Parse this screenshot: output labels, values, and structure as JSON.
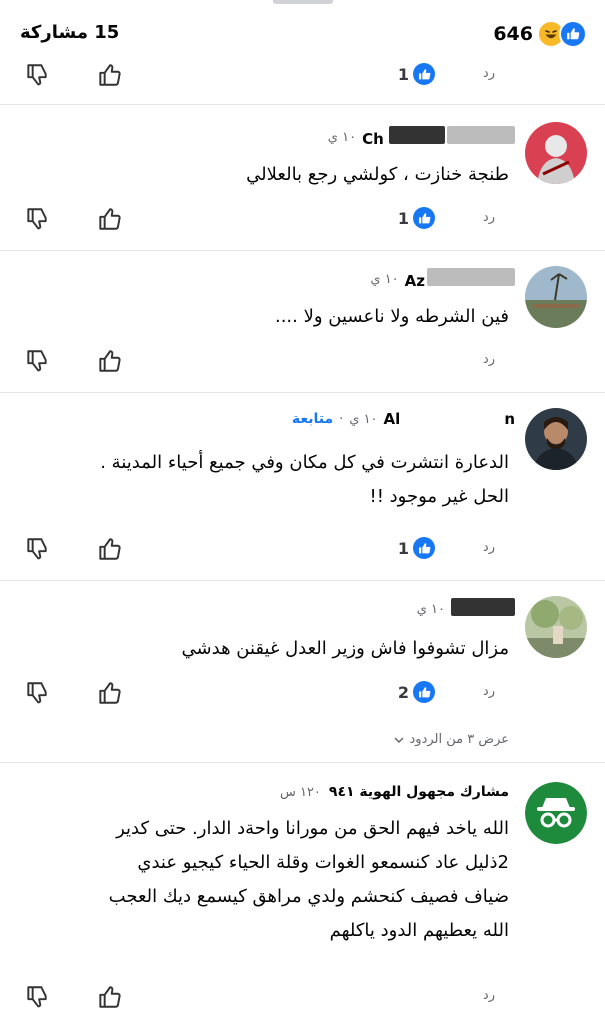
{
  "header": {
    "shares_text": "15 مشاركة",
    "reactions_count": "646",
    "reaction_icons": [
      "haha-icon",
      "like-icon"
    ]
  },
  "labels": {
    "reply": "رد"
  },
  "comments": [
    {
      "actions": {
        "likes": "1"
      }
    },
    {
      "name": "Ch",
      "time": "١٠ ي",
      "text": "طنجة خنازت ، كولشي رجع بالعلالي",
      "actions": {
        "likes": "1"
      }
    },
    {
      "name": "Az",
      "time": "١٠ ي",
      "text": "فين الشرطه ولا ناعسين ولا ....",
      "actions": {
        "likes": ""
      }
    },
    {
      "name": "Al",
      "name_suffix": "n",
      "time": "١٠ ي",
      "follow": "متابعة",
      "lines": [
        "الدعارة انتشرت في كل مكان وفي جميع أحياء المدينة .",
        "الحل غير موجود !!"
      ],
      "actions": {
        "likes": "1"
      }
    },
    {
      "time": "١٠ ي",
      "text": "مزال تشوفوا فاش وزير العدل غيقنن هدشي",
      "actions": {
        "likes": "2"
      },
      "show_replies": "عرض ٣ من الردود"
    },
    {
      "anon_name": "مشارك مجهول الهوية ٩٤١",
      "time": "١٢٠ س",
      "lines": [
        "الله ياخد فيهم الحق من مورانا  واحةد الدار. حتى كدير",
        "2ذليل عاد كنسمعو الغوات وقلة الحياء كيجيو عندي",
        "ضياف فصيف كنحشم ولدي مراهق كيسمع ديك العجب",
        "الله يعطيهم الدود ياكلهم"
      ],
      "actions": {
        "likes": ""
      }
    }
  ],
  "colors": {
    "accent": "#1877f2",
    "muted": "#65676b",
    "divider": "#e4e6eb"
  }
}
